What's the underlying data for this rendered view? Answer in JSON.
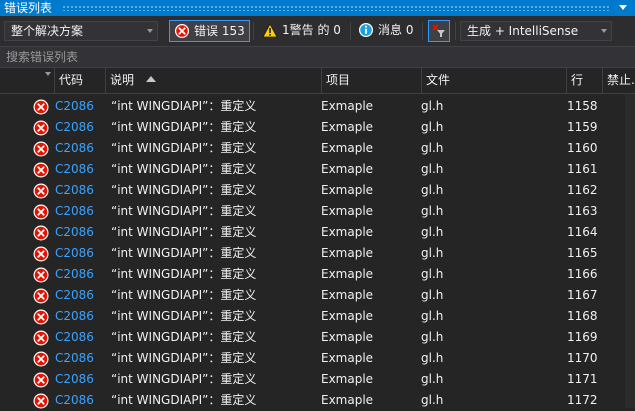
{
  "window": {
    "title": "错误列表"
  },
  "toolbar": {
    "scope": "整个解决方案",
    "errors_label": "错误 153",
    "warnings_label": "1警告 的 0",
    "messages_label": "消息 0",
    "source": "生成 + IntelliSense"
  },
  "search": {
    "placeholder": "搜索错误列表"
  },
  "columns": {
    "code": "代码",
    "description": "说明",
    "project": "项目",
    "file": "文件",
    "line": "行",
    "suppress": "禁止..."
  },
  "rows": [
    {
      "code": "C2086",
      "desc": "“int WINGDIAPI”：重定义",
      "project": "Exmaple",
      "file": "gl.h",
      "line": "1158"
    },
    {
      "code": "C2086",
      "desc": "“int WINGDIAPI”：重定义",
      "project": "Exmaple",
      "file": "gl.h",
      "line": "1159"
    },
    {
      "code": "C2086",
      "desc": "“int WINGDIAPI”：重定义",
      "project": "Exmaple",
      "file": "gl.h",
      "line": "1160"
    },
    {
      "code": "C2086",
      "desc": "“int WINGDIAPI”：重定义",
      "project": "Exmaple",
      "file": "gl.h",
      "line": "1161"
    },
    {
      "code": "C2086",
      "desc": "“int WINGDIAPI”：重定义",
      "project": "Exmaple",
      "file": "gl.h",
      "line": "1162"
    },
    {
      "code": "C2086",
      "desc": "“int WINGDIAPI”：重定义",
      "project": "Exmaple",
      "file": "gl.h",
      "line": "1163"
    },
    {
      "code": "C2086",
      "desc": "“int WINGDIAPI”：重定义",
      "project": "Exmaple",
      "file": "gl.h",
      "line": "1164"
    },
    {
      "code": "C2086",
      "desc": "“int WINGDIAPI”：重定义",
      "project": "Exmaple",
      "file": "gl.h",
      "line": "1165"
    },
    {
      "code": "C2086",
      "desc": "“int WINGDIAPI”：重定义",
      "project": "Exmaple",
      "file": "gl.h",
      "line": "1166"
    },
    {
      "code": "C2086",
      "desc": "“int WINGDIAPI”：重定义",
      "project": "Exmaple",
      "file": "gl.h",
      "line": "1167"
    },
    {
      "code": "C2086",
      "desc": "“int WINGDIAPI”：重定义",
      "project": "Exmaple",
      "file": "gl.h",
      "line": "1168"
    },
    {
      "code": "C2086",
      "desc": "“int WINGDIAPI”：重定义",
      "project": "Exmaple",
      "file": "gl.h",
      "line": "1169"
    },
    {
      "code": "C2086",
      "desc": "“int WINGDIAPI”：重定义",
      "project": "Exmaple",
      "file": "gl.h",
      "line": "1170"
    },
    {
      "code": "C2086",
      "desc": "“int WINGDIAPI”：重定义",
      "project": "Exmaple",
      "file": "gl.h",
      "line": "1171"
    },
    {
      "code": "C2086",
      "desc": "“int WINGDIAPI”：重定义",
      "project": "Exmaple",
      "file": "gl.h",
      "line": "1172"
    }
  ],
  "icons": {
    "error": "error-circle-x-icon",
    "warning": "warning-triangle-icon",
    "info": "info-circle-icon",
    "filter": "filter-clear-icon"
  },
  "colors": {
    "accent": "#007acc",
    "error": "#e51400",
    "warning": "#ffcc00",
    "info": "#1ba1e2",
    "link": "#3aa3ff"
  }
}
